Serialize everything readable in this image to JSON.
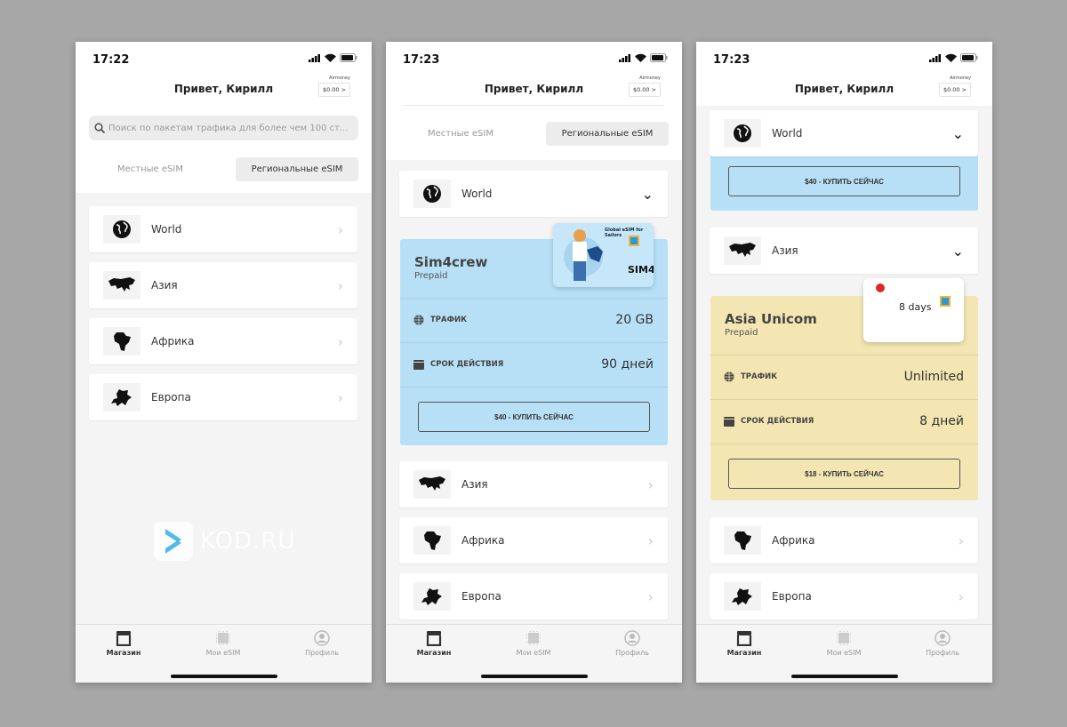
{
  "status": {
    "times": [
      "17:22",
      "17:23",
      "17:23"
    ]
  },
  "header": {
    "greeting": "Привет, Кирилл",
    "wallet_brand": "Airmoney",
    "balance": "$0.00 >"
  },
  "search": {
    "placeholder": "Поиск по пакетам трафика для более чем 100 ст..."
  },
  "tabs": {
    "local": "Местные eSIM",
    "regional": "Региональные eSIM",
    "selected": "regional"
  },
  "regions": [
    {
      "name": "World",
      "icon": "globe-icon"
    },
    {
      "name": "Азия",
      "icon": "asia-map-icon"
    },
    {
      "name": "Африка",
      "icon": "africa-map-icon"
    },
    {
      "name": "Европа",
      "icon": "europe-map-icon"
    }
  ],
  "plans": [
    {
      "name": "Sim4crew",
      "type": "Prepaid",
      "traffic_label": "ТРАФИК",
      "traffic": "20 GB",
      "validity_label": "СРОК ДЕЙСТВИЯ",
      "validity": "90 дней",
      "buy": "$40 - КУПИТЬ СЕЙЧАС",
      "color": "#b7e0f6",
      "card_text": "Global eSIM for Sailors",
      "card_logo": "SIM4"
    },
    {
      "name": "Asia Unicom",
      "type": "Prepaid",
      "traffic_label": "ТРАФИК",
      "traffic": "Unlimited",
      "validity_label": "СРОК ДЕЙСТВИЯ",
      "validity": "8 дней",
      "buy": "$18 - КУПИТЬ СЕЙЧАС",
      "color": "#f3e6b3",
      "card_text": "8 days"
    }
  ],
  "nav": [
    {
      "label": "Магазин",
      "icon": "store-icon",
      "active": true
    },
    {
      "label": "Мои eSIM",
      "icon": "sim-chip-icon",
      "active": false
    },
    {
      "label": "Профиль",
      "icon": "profile-icon",
      "active": false
    }
  ],
  "watermark": "KOD.RU",
  "colors": {
    "background": "#a7a7a7",
    "sim4crew_card": "#b7e0f6",
    "unicom_card": "#f3e6b3"
  }
}
